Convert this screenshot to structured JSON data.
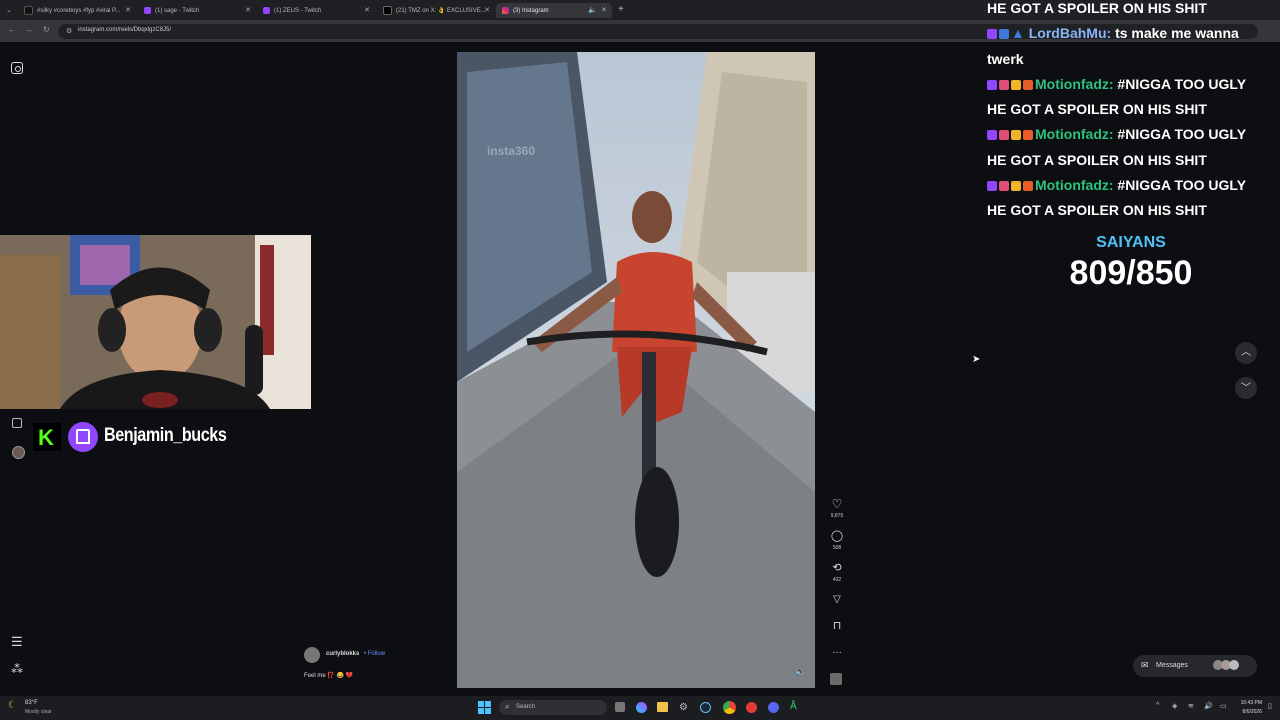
{
  "browser": {
    "tabs": [
      {
        "title": "#silky #coreboys #fyp #viral P..."
      },
      {
        "title": "(1) sage - Twitch"
      },
      {
        "title": "(1) ZEUS - Twitch"
      },
      {
        "title": "(21) TMZ on X: 👌 EXCLUSIVE..."
      },
      {
        "title": "(3) Instagram"
      }
    ],
    "url": "instagram.com/reels/DbqxlgzC8J5/"
  },
  "reel": {
    "watermark": "insta360",
    "likes": "9,875",
    "comments": "508",
    "reposts": "432",
    "author": "curlyblokks",
    "follow_label": "• Follow",
    "caption": "Feel me ⁉️ 😂 💔"
  },
  "overlay": {
    "streamer_name": "Benjamin_bucks",
    "goal_title": "SAIYANS",
    "goal_value": "809/850",
    "chat": [
      {
        "user": "",
        "text": "HE GOT A SPOILER ON HIS SHIT"
      },
      {
        "user": "LordBahMu:",
        "text": "ts make me wanna"
      },
      {
        "user": "",
        "text": "twerk"
      },
      {
        "user": "Motionfadz:",
        "text": "#NIGGA TOO UGLY"
      },
      {
        "user": "",
        "text": "HE GOT A SPOILER ON HIS SHIT"
      },
      {
        "user": "Motionfadz:",
        "text": "#NIGGA TOO UGLY"
      },
      {
        "user": "",
        "text": "HE GOT A SPOILER ON HIS SHIT"
      },
      {
        "user": "Motionfadz:",
        "text": "#NIGGA TOO UGLY"
      },
      {
        "user": "",
        "text": "HE GOT A SPOILER ON HIS SHIT"
      }
    ]
  },
  "messages": {
    "label": "Messages"
  },
  "taskbar": {
    "weather_temp": "83°F",
    "weather_desc": "Mostly clear",
    "search_placeholder": "Search",
    "time": "10:43 PM",
    "date": "8/6/2026"
  }
}
